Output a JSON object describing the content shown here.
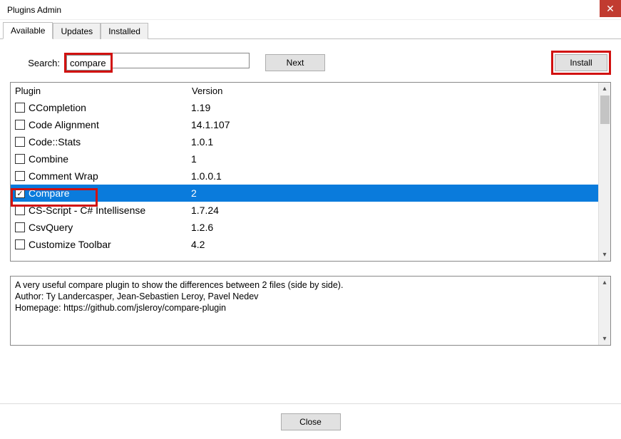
{
  "window": {
    "title": "Plugins Admin"
  },
  "tabs": {
    "available": "Available",
    "updates": "Updates",
    "installed": "Installed"
  },
  "search": {
    "label": "Search:",
    "value": "compare",
    "next_label": "Next"
  },
  "actions": {
    "install_label": "Install"
  },
  "list": {
    "headers": {
      "plugin": "Plugin",
      "version": "Version"
    },
    "rows": [
      {
        "name": "CCompletion",
        "version": "1.19",
        "checked": false,
        "selected": false
      },
      {
        "name": "Code Alignment",
        "version": "14.1.107",
        "checked": false,
        "selected": false
      },
      {
        "name": "Code::Stats",
        "version": "1.0.1",
        "checked": false,
        "selected": false
      },
      {
        "name": "Combine",
        "version": "1",
        "checked": false,
        "selected": false
      },
      {
        "name": "Comment Wrap",
        "version": "1.0.0.1",
        "checked": false,
        "selected": false
      },
      {
        "name": "Compare",
        "version": "2",
        "checked": true,
        "selected": true
      },
      {
        "name": "CS-Script - C# Intellisense",
        "version": "1.7.24",
        "checked": false,
        "selected": false
      },
      {
        "name": "CsvQuery",
        "version": "1.2.6",
        "checked": false,
        "selected": false
      },
      {
        "name": "Customize Toolbar",
        "version": "4.2",
        "checked": false,
        "selected": false
      }
    ]
  },
  "description": {
    "line1": "A very useful compare plugin to show the differences between 2 files (side by side).",
    "line2": "Author: Ty Landercasper, Jean-Sebastien Leroy, Pavel Nedev",
    "line3": "Homepage: https://github.com/jsleroy/compare-plugin"
  },
  "footer": {
    "close_label": "Close"
  },
  "highlights": {
    "search_input": true,
    "install_button": true,
    "compare_row": true
  }
}
